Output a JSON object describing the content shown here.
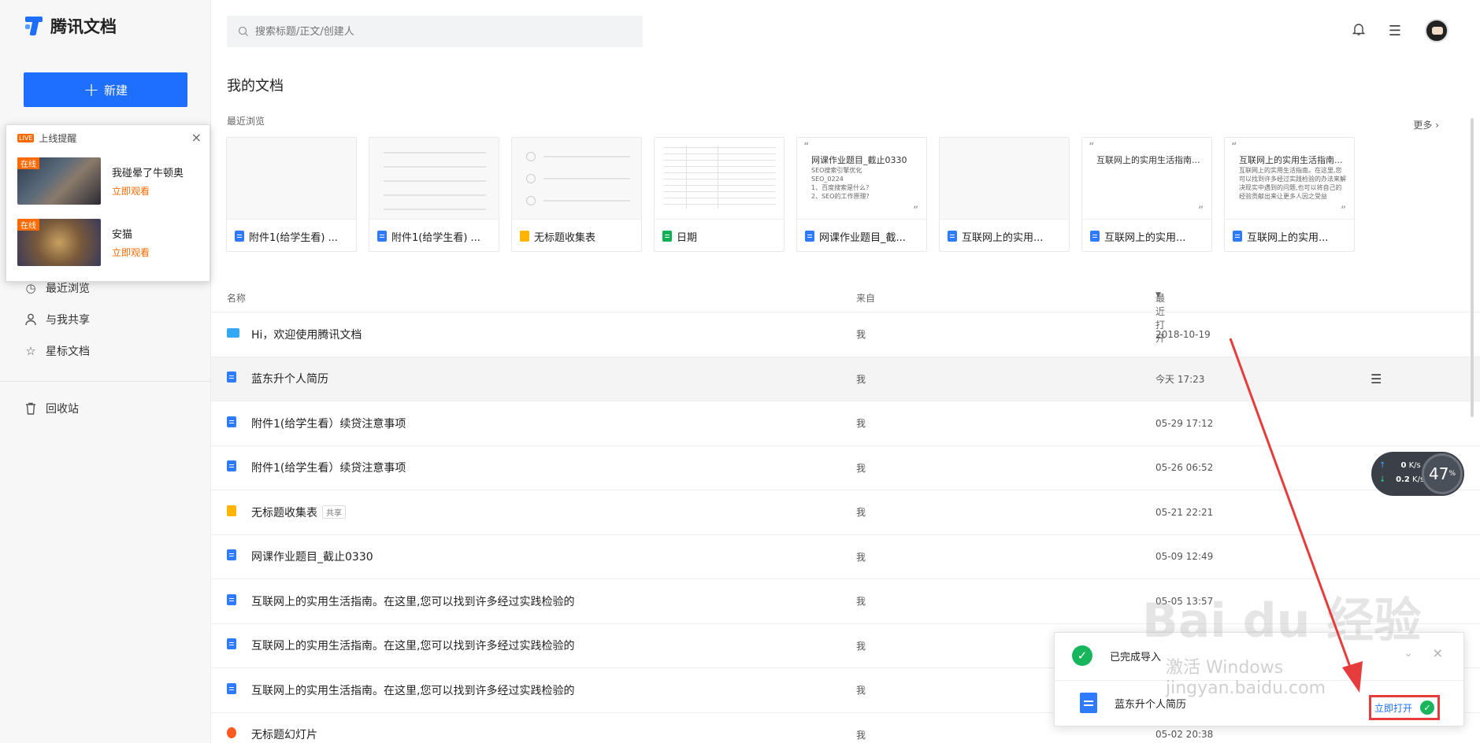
{
  "app": {
    "name": "腾讯文档"
  },
  "sidebar": {
    "new_button": "新建",
    "nav": [
      {
        "label": "最近浏览",
        "icon": "clock-icon"
      },
      {
        "label": "与我共享",
        "icon": "user-icon"
      },
      {
        "label": "星标文档",
        "icon": "star-icon"
      },
      {
        "label": "回收站",
        "icon": "trash-icon"
      }
    ]
  },
  "popup": {
    "badge": "LIVE",
    "title": "上线提醒",
    "items": [
      {
        "tag": "在线",
        "name": "我碰晕了牛顿奥",
        "action": "立即观看"
      },
      {
        "tag": "在线",
        "name": "安猫",
        "action": "立即观看"
      }
    ]
  },
  "search": {
    "placeholder": "搜索标题/正文/创建人"
  },
  "main": {
    "title": "我的文档",
    "recent_label": "最近浏览",
    "more": "更多"
  },
  "recent_cards": [
    {
      "title": "附件1(给学生看) ...",
      "type": "doc"
    },
    {
      "title": "附件1(给学生看) ...",
      "type": "doc"
    },
    {
      "title": "无标题收集表",
      "type": "form"
    },
    {
      "title": "日期",
      "type": "sheet"
    },
    {
      "title": "网课作业题目_截...",
      "type": "doc",
      "preview_title": "网课作业题目_截止0330",
      "preview_body": "SEO搜索引擎优化\nSEO_0224\n1、百度搜索是什么?\n2、SEO的工作原理?"
    },
    {
      "title": "互联网上的实用...",
      "type": "doc"
    },
    {
      "title": "互联网上的实用...",
      "type": "doc",
      "preview_title": "互联网上的实用生活指南..."
    },
    {
      "title": "互联网上的实用...",
      "type": "doc",
      "preview_title": "互联网上的实用生活指南...",
      "preview_body": "互联网上的实用生活指南。在这里,您可以找到许多经过实践检验的办法来解决现实中遇到的问题,也可以将自己的经验贡献出来让更多人因之受益"
    }
  ],
  "table": {
    "columns": {
      "name": "名称",
      "from": "来自",
      "time": "最近打开"
    },
    "rows": [
      {
        "icon": "folder",
        "name": "Hi，欢迎使用腾讯文档",
        "from": "我",
        "time": "2018-10-19"
      },
      {
        "icon": "doc",
        "name": "蓝东升个人简历",
        "from": "我",
        "time": "今天 17:23",
        "highlight": true
      },
      {
        "icon": "doc",
        "name": "附件1(给学生看）续贷注意事项",
        "from": "我",
        "time": "05-29 17:12"
      },
      {
        "icon": "doc",
        "name": "附件1(给学生看）续贷注意事项",
        "from": "我",
        "time": "05-26 06:52"
      },
      {
        "icon": "form",
        "name": "无标题收集表",
        "share": "共享",
        "from": "我",
        "time": "05-21 22:21"
      },
      {
        "icon": "doc",
        "name": "网课作业题目_截止0330",
        "from": "我",
        "time": "05-09 12:49"
      },
      {
        "icon": "doc",
        "name": "互联网上的实用生活指南。在这里,您可以找到许多经过实践检验的",
        "from": "我",
        "time": "05-05 13:57"
      },
      {
        "icon": "doc",
        "name": "互联网上的实用生活指南。在这里,您可以找到许多经过实践检验的",
        "from": "我",
        "time": ""
      },
      {
        "icon": "doc",
        "name": "互联网上的实用生活指南。在这里,您可以找到许多经过实践检验的",
        "from": "我",
        "time": ""
      },
      {
        "icon": "slide",
        "name": "无标题幻灯片",
        "from": "我",
        "time": "05-02 20:38"
      }
    ]
  },
  "speed_widget": {
    "up": "0",
    "down": "0.2",
    "unit": "K/s",
    "percent": "47",
    "percent_unit": "%"
  },
  "toast": {
    "status": "已完成导入",
    "file": "蓝东升个人简历",
    "open_button": "立即打开"
  },
  "watermark": {
    "brand": "Bai du 经验",
    "url": "jingyan.baidu.com",
    "activate": "激活 Windows"
  },
  "colors": {
    "accent": "#1e6fff",
    "success": "#17b55c",
    "live": "#ff6a00",
    "annotation": "#e63c3c"
  }
}
